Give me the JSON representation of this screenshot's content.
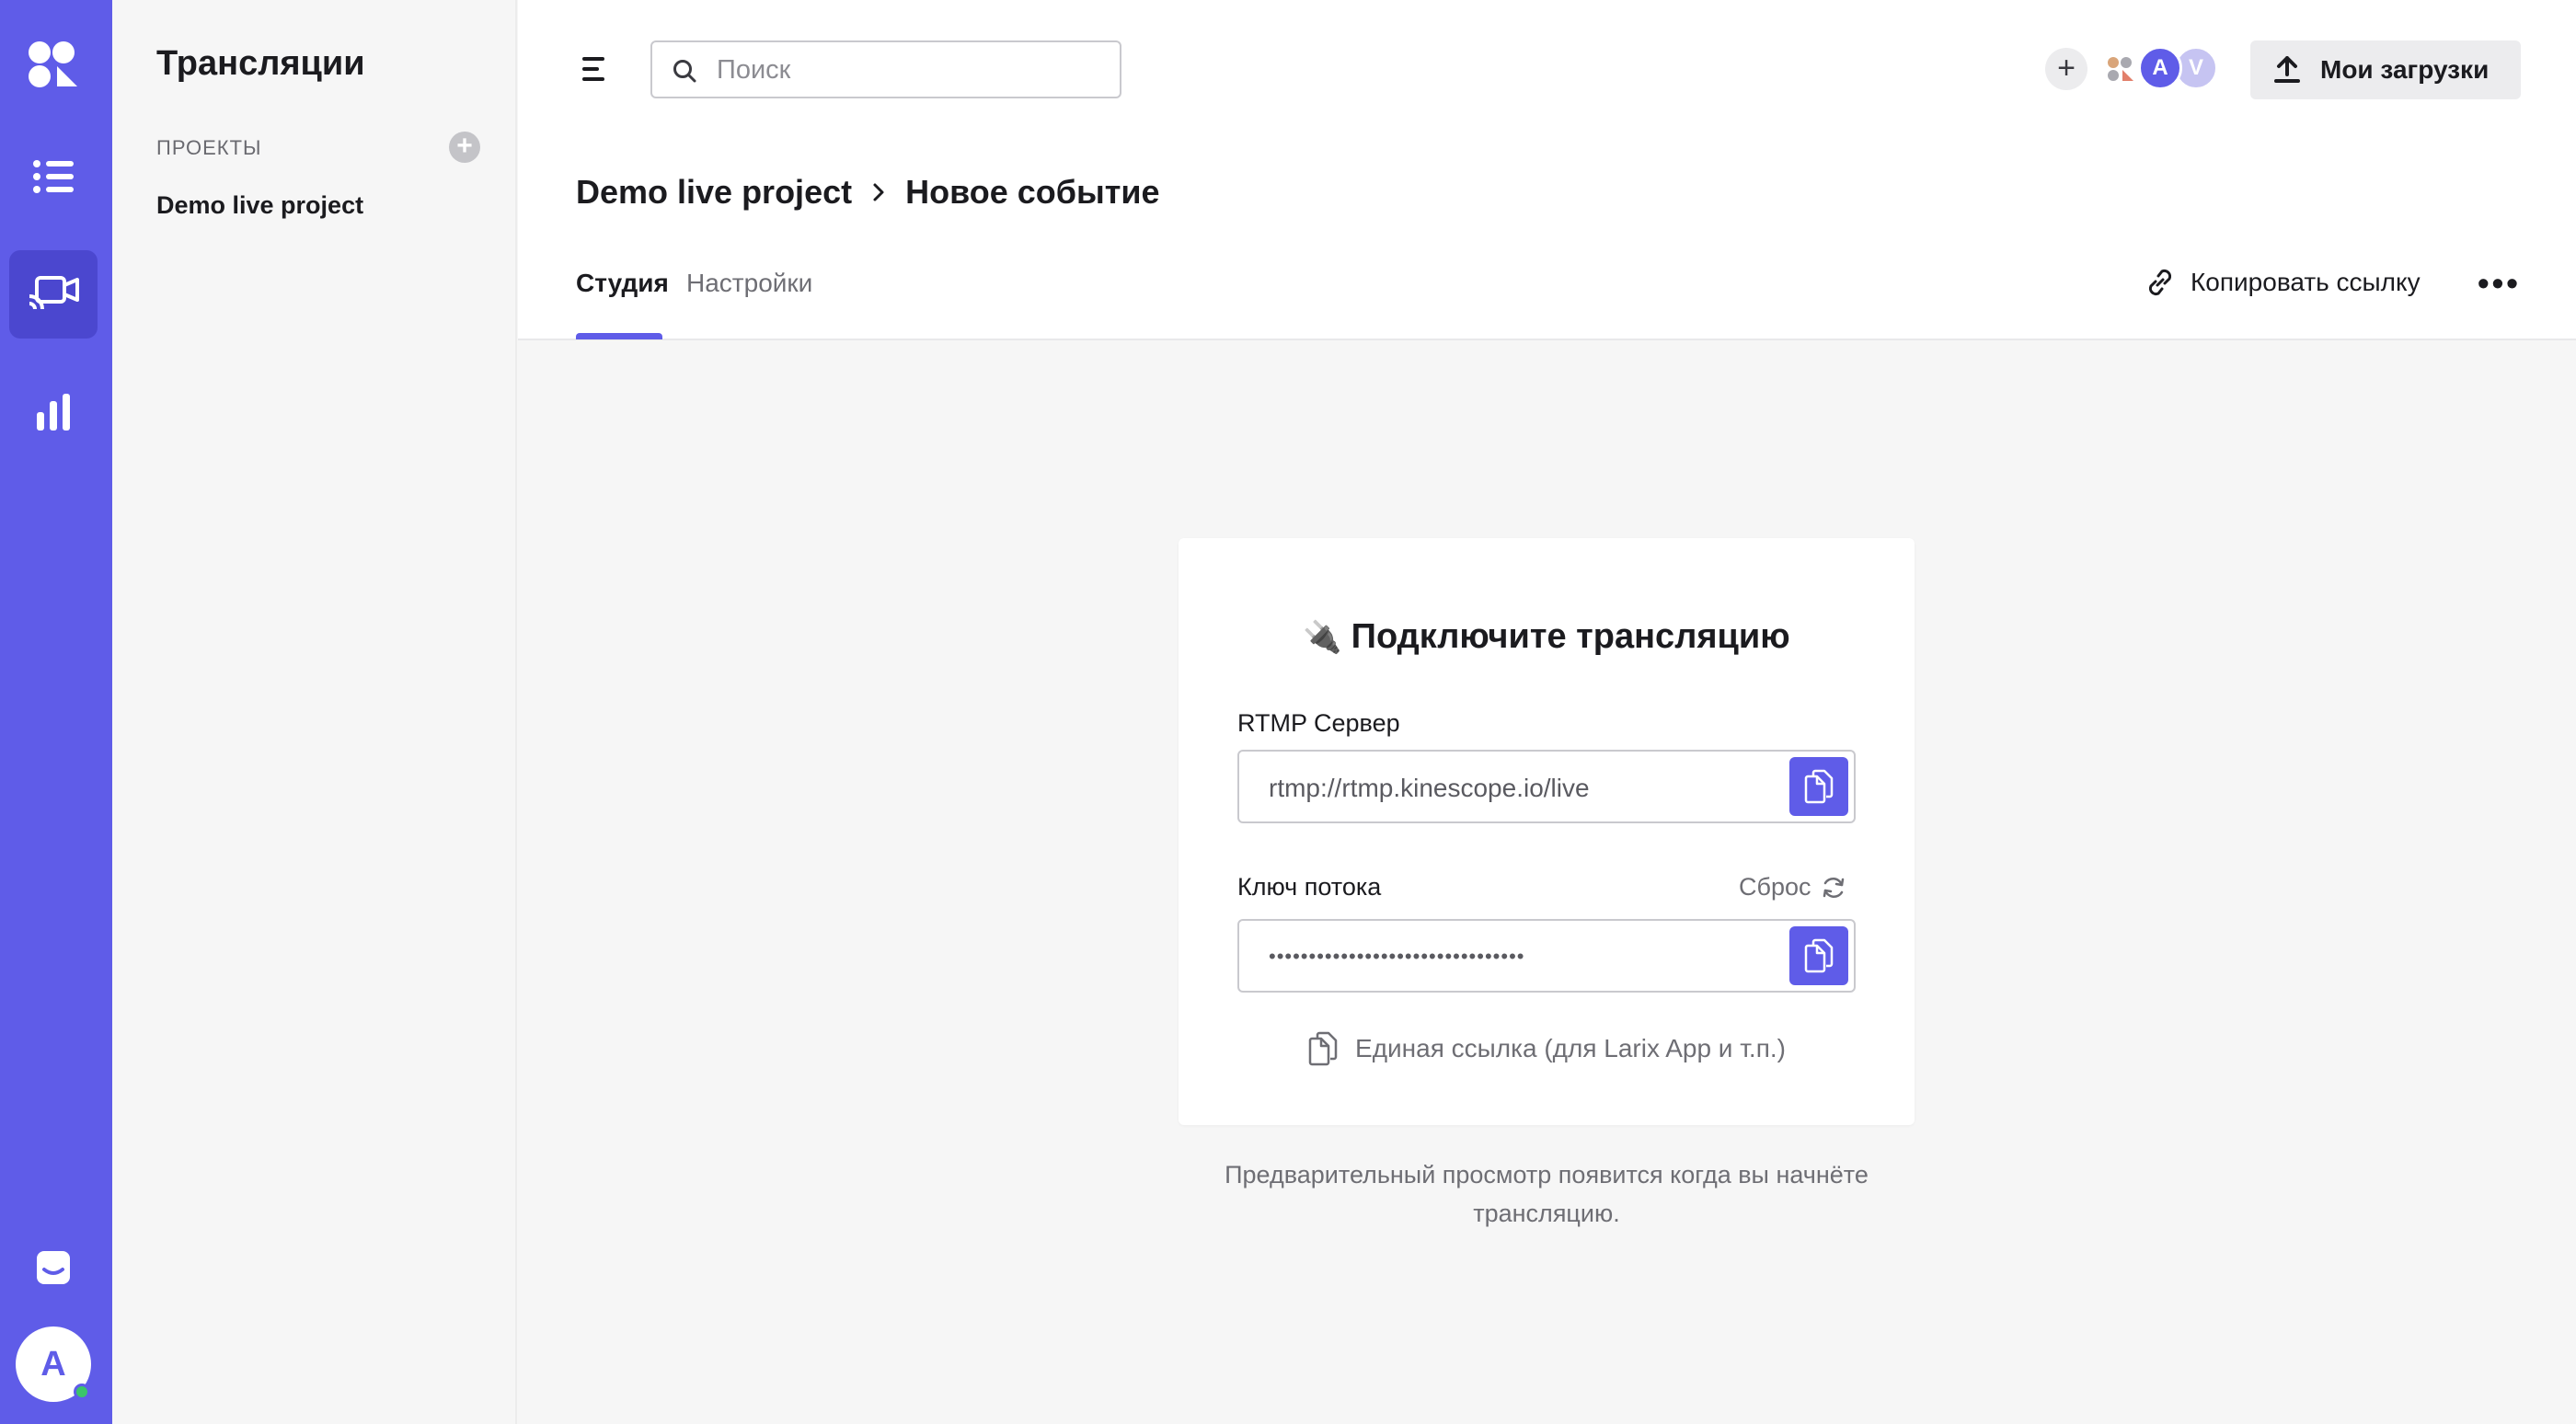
{
  "sidebar": {
    "title": "Трансляции",
    "section_label": "ПРОЕКТЫ",
    "projects": [
      "Demo live project"
    ]
  },
  "rail": {
    "user_initial": "A",
    "accent_color": "#5f5ce8"
  },
  "header": {
    "search_placeholder": "Поиск",
    "avatars": [
      "A",
      "V"
    ],
    "uploads_label": "Мои загрузки"
  },
  "breadcrumb": {
    "project": "Demo live project",
    "event": "Новое событие"
  },
  "tabs": [
    {
      "label": "Студия",
      "active": true
    },
    {
      "label": "Настройки",
      "active": false
    }
  ],
  "actions": {
    "copy_link_label": "Копировать ссылку",
    "more_label": "•••"
  },
  "card": {
    "title": "Подключите трансляцию",
    "rtmp_label": "RTMP Сервер",
    "rtmp_value": "rtmp://rtmp.kinescope.io/live",
    "key_label": "Ключ потока",
    "reset_label": "Сброс",
    "key_value": "••••••••••••••••••••••••••••••••",
    "single_link_label": "Единая ссылка (для Larix App и т.п.)"
  },
  "preview_note": "Предварительный просмотр появится когда вы начнёте трансляцию."
}
